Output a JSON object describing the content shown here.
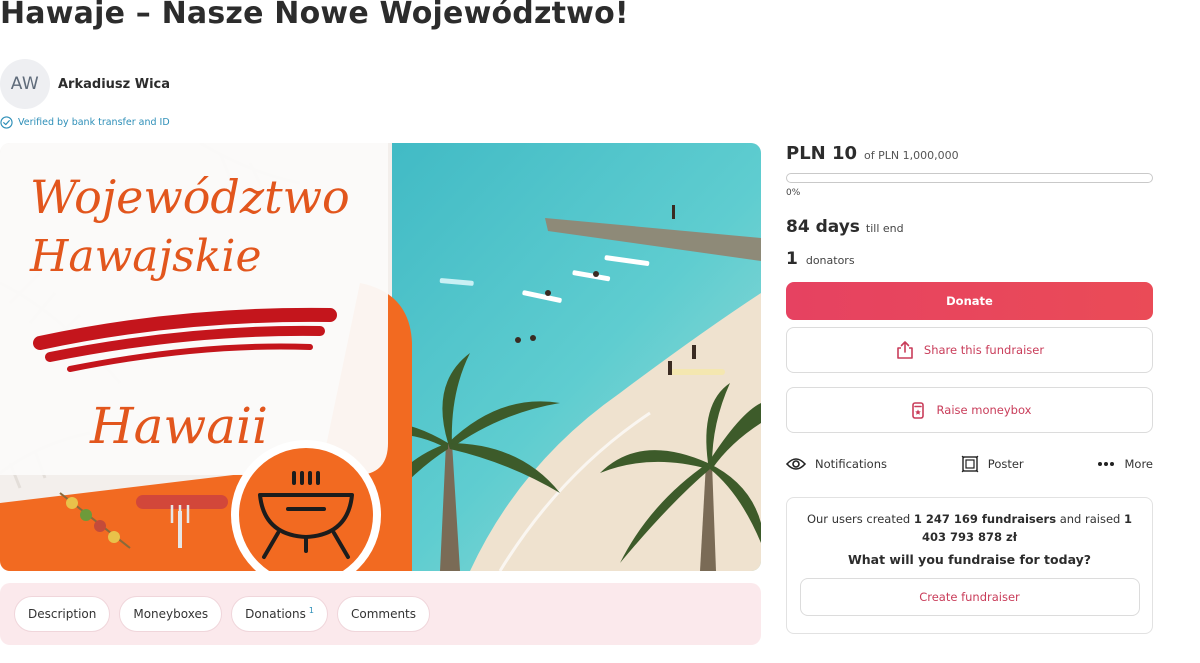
{
  "page": {
    "title": "Hawaje – Nasze Nowe Województwo!"
  },
  "author": {
    "initials": "AW",
    "name": "Arkadiusz Wica",
    "verified_text": "Verified by bank transfer and ID"
  },
  "hero": {
    "script_line1": "Województwo",
    "script_line2": "Hawajskie",
    "script_line3": "Hawaii"
  },
  "tabs": [
    {
      "label": "Description"
    },
    {
      "label": "Moneyboxes"
    },
    {
      "label": "Donations",
      "count": "1"
    },
    {
      "label": "Comments"
    }
  ],
  "fundraiser": {
    "raised": "PLN 10",
    "goal_text": "of PLN 1,000,000",
    "progress_percent": 0,
    "progress_label": "0%",
    "days_value": "84 days",
    "days_label": "till end",
    "donators_value": "1",
    "donators_label": "donators"
  },
  "buttons": {
    "donate": "Donate",
    "share": "Share this fundraiser",
    "moneybox": "Raise moneybox"
  },
  "actions": {
    "notifications": "Notifications",
    "poster": "Poster",
    "more": "More"
  },
  "promo": {
    "text_prefix": "Our users created ",
    "fundraisers_count": "1 247 169 fundraisers",
    "text_middle": " and raised ",
    "raised_total": "1 403 793 878 zł",
    "question": "What will you fundraise for today?",
    "create_button": "Create fundraiser"
  },
  "colors": {
    "accent": "#e8405a",
    "link_pink": "#c93d5a",
    "verified_blue": "#2e8fb8",
    "tabs_background": "#fbe9ec",
    "hero_orange": "#f26a21"
  }
}
